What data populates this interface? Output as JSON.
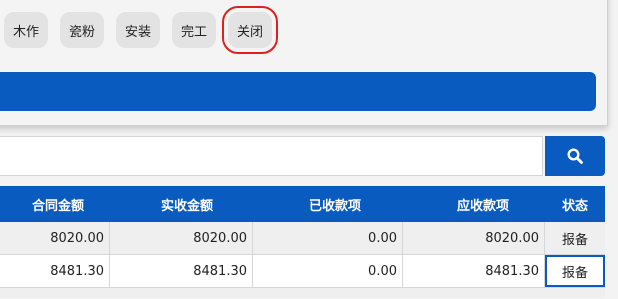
{
  "status_filter": {
    "buttons": [
      "木作",
      "瓷粉",
      "安装",
      "完工",
      "关闭"
    ],
    "selected": "关闭"
  },
  "search": {
    "icon": "search-icon"
  },
  "colors": {
    "primary": "#0a5bbf",
    "selected_outline": "#e0201c"
  },
  "table": {
    "headers": [
      "合同金额",
      "实收金额",
      "已收款项",
      "应收款项",
      "状态"
    ],
    "rows": [
      [
        "8020.00",
        "8020.00",
        "0.00",
        "8020.00",
        "报备"
      ],
      [
        "8481.30",
        "8481.30",
        "0.00",
        "8481.30",
        "报备"
      ]
    ]
  }
}
